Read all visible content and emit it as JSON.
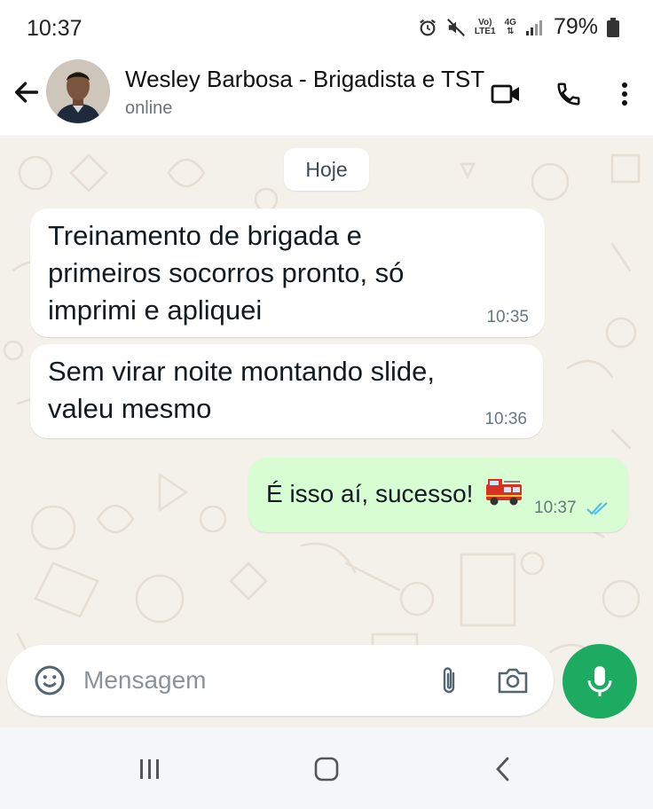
{
  "status_bar": {
    "time": "10:37",
    "network_top": "Vo)",
    "network_bottom": "LTE1",
    "network_type": "4G",
    "battery": "79%"
  },
  "header": {
    "contact_name": "Wesley Barbosa - Brigadista e TST",
    "status": "online",
    "icons": [
      "back-arrow-icon",
      "video-call-icon",
      "phone-icon",
      "more-vert-icon"
    ]
  },
  "chat": {
    "date_label": "Hoje",
    "messages": [
      {
        "direction": "incoming",
        "lines": [
          "Treinamento de brigada e",
          "primeiros socorros pronto, só",
          "imprimi e apliquei"
        ],
        "time": "10:35"
      },
      {
        "direction": "incoming",
        "lines": [
          "Sem virar noite montando slide,",
          "valeu mesmo"
        ],
        "time": "10:36"
      },
      {
        "direction": "outgoing",
        "text": "É isso aí, sucesso!",
        "emoji": "fire-engine",
        "time": "10:37",
        "status": "read"
      }
    ]
  },
  "composer": {
    "placeholder": "Mensagem",
    "icons": [
      "emoji-icon",
      "attach-icon",
      "camera-icon",
      "mic-icon"
    ]
  },
  "colors": {
    "outgoing_bubble": "#d9fdd3",
    "incoming_bubble": "#ffffff",
    "wallpaper": "#f4f0ea",
    "accent_green": "#1daa61",
    "read_ticks": "#53bdeb"
  }
}
